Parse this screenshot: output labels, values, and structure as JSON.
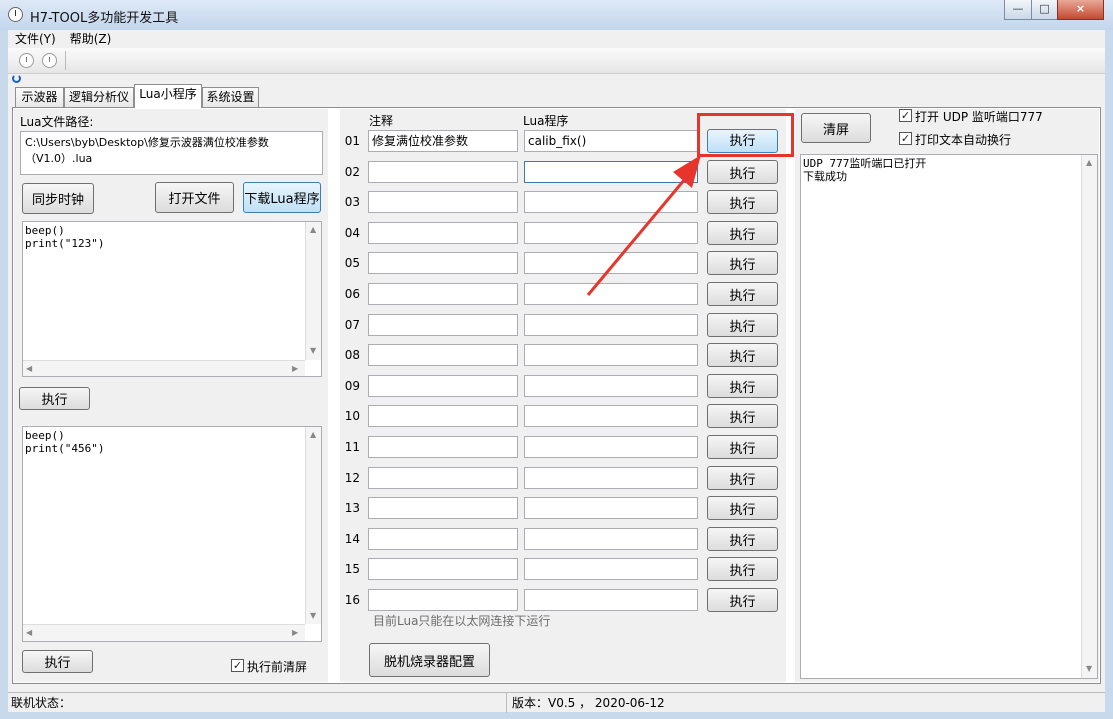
{
  "window": {
    "title": "H7-TOOL多功能开发工具",
    "min": "—",
    "max": "□",
    "close": "×"
  },
  "menu": [
    "文件(Y)",
    "帮助(Z)"
  ],
  "tabs": [
    "示波器",
    "逻辑分析仪",
    "Lua小程序",
    "系统设置"
  ],
  "left": {
    "path_label": "Lua文件路径:",
    "path_value": "C:\\Users\\byb\\Desktop\\修复示波器满位校准参数\n（V1.0）.lua",
    "sync_button": "同步时钟",
    "open_button": "打开文件",
    "download_button": "下载Lua程序",
    "script1": "beep()\nprint(\"123\")",
    "run1_button": "执行",
    "script2": "beep()\nprint(\"456\")",
    "run2_button": "执行",
    "clear_before_run_label": "执行前清屏",
    "clear_before_run_checked": true
  },
  "middle": {
    "col_note": "注释",
    "col_lua": "Lua程序",
    "rows": [
      {
        "num": "01",
        "note": "修复满位校准参数",
        "lua": "calib_fix()",
        "btn": "执行"
      },
      {
        "num": "02",
        "note": "",
        "lua": "",
        "btn": "执行"
      },
      {
        "num": "03",
        "note": "",
        "lua": "",
        "btn": "执行"
      },
      {
        "num": "04",
        "note": "",
        "lua": "",
        "btn": "执行"
      },
      {
        "num": "05",
        "note": "",
        "lua": "",
        "btn": "执行"
      },
      {
        "num": "06",
        "note": "",
        "lua": "",
        "btn": "执行"
      },
      {
        "num": "07",
        "note": "",
        "lua": "",
        "btn": "执行"
      },
      {
        "num": "08",
        "note": "",
        "lua": "",
        "btn": "执行"
      },
      {
        "num": "09",
        "note": "",
        "lua": "",
        "btn": "执行"
      },
      {
        "num": "10",
        "note": "",
        "lua": "",
        "btn": "执行"
      },
      {
        "num": "11",
        "note": "",
        "lua": "",
        "btn": "执行"
      },
      {
        "num": "12",
        "note": "",
        "lua": "",
        "btn": "执行"
      },
      {
        "num": "13",
        "note": "",
        "lua": "",
        "btn": "执行"
      },
      {
        "num": "14",
        "note": "",
        "lua": "",
        "btn": "执行"
      },
      {
        "num": "15",
        "note": "",
        "lua": "",
        "btn": "执行"
      },
      {
        "num": "16",
        "note": "",
        "lua": "",
        "btn": "执行"
      }
    ],
    "hint": "目前Lua只能在以太网连接下运行",
    "offline_button": "脱机烧录器配置"
  },
  "right": {
    "clear_button": "清屏",
    "udp_label": "打开 UDP 监听端口777",
    "udp_checked": true,
    "wrap_label": "打印文本自动换行",
    "wrap_checked": true,
    "output": "UDP 777监听端口已打开\n下载成功"
  },
  "status": {
    "conn_label": "联机状态：",
    "version": "版本：V0.5 ， 2020-06-12"
  },
  "annotation": {
    "color": "#e8352b"
  }
}
